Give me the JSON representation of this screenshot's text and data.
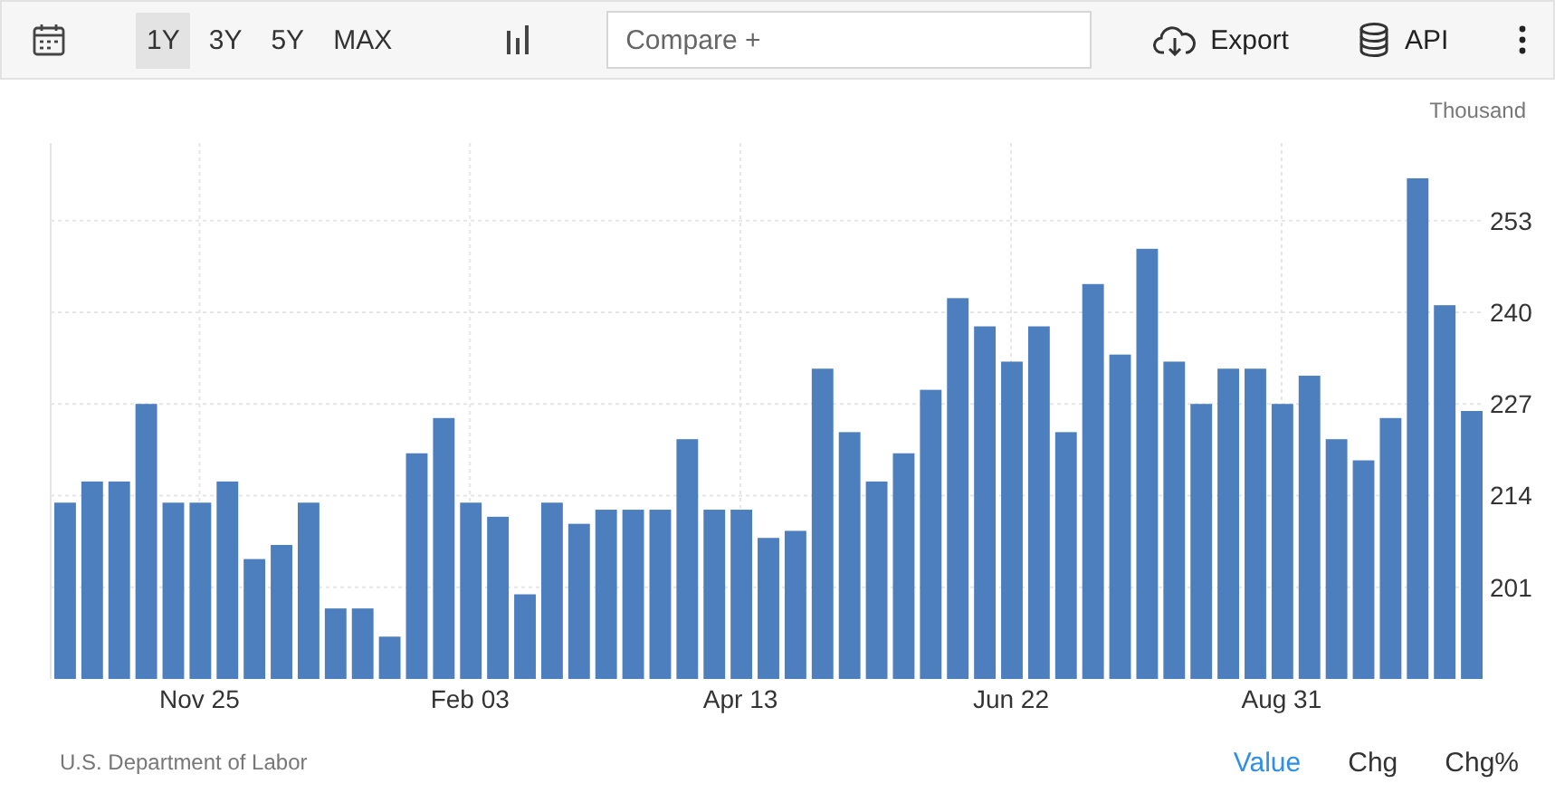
{
  "toolbar": {
    "ranges": [
      {
        "label": "1Y",
        "selected": true
      },
      {
        "label": "3Y",
        "selected": false
      },
      {
        "label": "5Y",
        "selected": false
      },
      {
        "label": "MAX",
        "selected": false
      }
    ],
    "compare": {
      "placeholder": "Compare +"
    },
    "actions": [
      {
        "kind": "export",
        "label": "Export"
      },
      {
        "kind": "api",
        "label": "API"
      }
    ]
  },
  "chart": {
    "unit": "Thousand",
    "chart_data": {
      "type": "bar",
      "categories": [
        null,
        null,
        null,
        null,
        null,
        "Nov 25",
        null,
        null,
        null,
        null,
        null,
        null,
        null,
        null,
        null,
        "Feb 03",
        null,
        null,
        null,
        null,
        null,
        null,
        null,
        null,
        null,
        "Apr 13",
        null,
        null,
        null,
        null,
        null,
        null,
        null,
        null,
        null,
        "Jun 22",
        null,
        null,
        null,
        null,
        null,
        null,
        null,
        null,
        null,
        "Aug 31",
        null,
        null,
        null,
        null,
        null,
        null,
        null
      ],
      "series": [
        {
          "color": "#4d7fbe",
          "values": [
            213,
            216,
            216,
            227,
            213,
            213,
            216,
            205,
            207,
            213,
            198,
            198,
            194,
            220,
            225,
            213,
            211,
            200,
            213,
            210,
            212,
            212,
            212,
            222,
            212,
            212,
            208,
            209,
            232,
            223,
            216,
            220,
            229,
            242,
            238,
            233,
            238,
            223,
            244,
            234,
            249,
            233,
            227,
            232,
            232,
            227,
            231,
            222,
            219,
            225,
            259,
            241,
            226
          ]
        }
      ],
      "ylim": [
        188,
        264
      ],
      "yticks": [
        201,
        214,
        227,
        240,
        253
      ],
      "grid": true
    }
  },
  "footer": {
    "source": "U.S. Department of Labor",
    "views": [
      {
        "label": "Value",
        "selected": true
      },
      {
        "label": "Chg",
        "selected": false
      },
      {
        "label": "Chg%",
        "selected": false
      }
    ]
  }
}
